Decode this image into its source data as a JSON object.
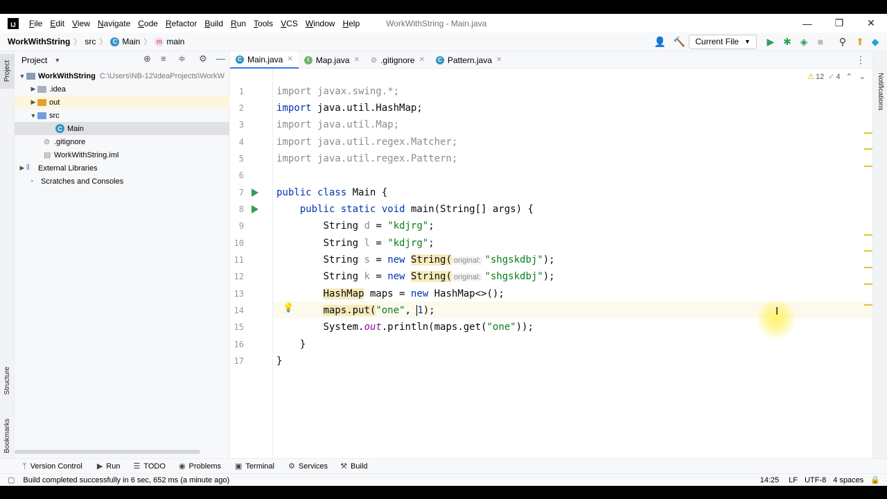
{
  "window": {
    "logo": "IJ",
    "menu": [
      "File",
      "Edit",
      "View",
      "Navigate",
      "Code",
      "Refactor",
      "Build",
      "Run",
      "Tools",
      "VCS",
      "Window",
      "Help"
    ],
    "title": "WorkWithString - Main.java",
    "controls": [
      "—",
      "❐",
      "✕"
    ]
  },
  "navbar": {
    "project": "WorkWithString",
    "crumbs": [
      "src",
      "Main",
      "main"
    ],
    "run_config": "Current File"
  },
  "left_strip": {
    "project_tab": "Project",
    "structure_tab": "Structure",
    "bookmarks_tab": "Bookmarks"
  },
  "right_strip": {
    "notifications_tab": "Notifications"
  },
  "project_panel": {
    "title": "Project",
    "tree": [
      {
        "name": "WorkWithString",
        "path": "C:\\Users\\NB-12\\IdeaProjects\\WorkW",
        "bold": true
      },
      {
        "name": ".idea"
      },
      {
        "name": "out"
      },
      {
        "name": "src"
      },
      {
        "name": "Main",
        "selected": true
      },
      {
        "name": ".gitignore"
      },
      {
        "name": "WorkWithString.iml"
      },
      {
        "name": "External Libraries"
      },
      {
        "name": "Scratches and Consoles"
      }
    ]
  },
  "tabs": [
    {
      "label": "Main.java",
      "active": true
    },
    {
      "label": "Map.java"
    },
    {
      "label": ".gitignore"
    },
    {
      "label": "Pattern.java"
    }
  ],
  "inspections": {
    "warnings": "12",
    "weak": "4"
  },
  "editor": {
    "line_numbers": [
      "1",
      "2",
      "3",
      "4",
      "5",
      "6",
      "7",
      "8",
      "9",
      "10",
      "11",
      "12",
      "13",
      "14",
      "15",
      "16",
      "17"
    ],
    "hint_label": "original:",
    "l1": "import javax.swing.*;",
    "l2a": "import ",
    "l2b": "java.util.HashMap;",
    "l3": "import java.util.Map;",
    "l4": "import java.util.regex.Matcher;",
    "l5": "import java.util.regex.Pattern;",
    "l7a": "public class ",
    "l7b": "Main {",
    "l8a": "public static void ",
    "l8b": "main(String[] args) {",
    "l9a": "String ",
    "l9b": "d",
    "l9c": " = ",
    "l9d": "\"kdjrg\"",
    "l9e": ";",
    "l10a": "String ",
    "l10b": "l",
    "l10c": " = ",
    "l10d": "\"kdjrg\"",
    "l10e": ";",
    "l11a": "String ",
    "l11b": "s",
    "l11c": " = ",
    "l11d": "new ",
    "l11e": "String(",
    "l11f": "\"shgskdbj\"",
    "l11g": ");",
    "l12a": "String ",
    "l12b": "k",
    "l12c": " = ",
    "l12d": "new ",
    "l12e": "String(",
    "l12f": "\"shgskdbj\"",
    "l12g": ");",
    "l13a": "HashMap",
    "l13b": " maps = ",
    "l13c": "new ",
    "l13d": "HashMap<>();",
    "l14a": "maps.put(",
    "l14b": "\"one\"",
    "l14c": ", ",
    "l14d": "1",
    "l14e": ");",
    "l15a": "System.",
    "l15b": "out",
    "l15c": ".println(maps.get(",
    "l15d": "\"one\"",
    "l15e": "));",
    "l16": "}",
    "l17": "}"
  },
  "tool_windows": [
    "Version Control",
    "Run",
    "TODO",
    "Problems",
    "Terminal",
    "Services",
    "Build"
  ],
  "status": {
    "message": "Build completed successfully in 6 sec, 652 ms (a minute ago)",
    "position": "14:25",
    "line_sep": "LF",
    "encoding": "UTF-8",
    "indent": "4 spaces"
  },
  "colors": {
    "accent": "#3574f0",
    "keyword": "#0033b3",
    "string": "#067d17",
    "run": "#2f9e53"
  }
}
